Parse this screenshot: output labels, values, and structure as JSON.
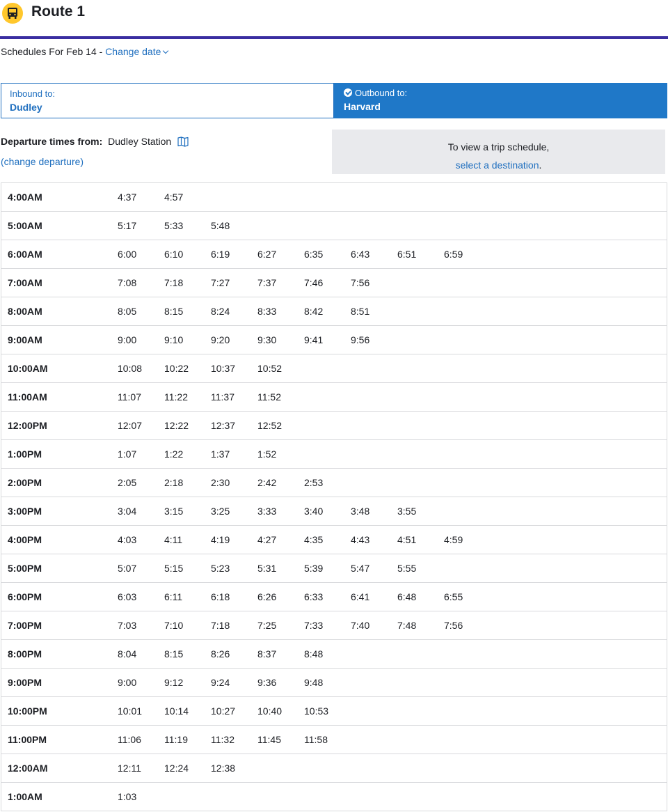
{
  "header": {
    "title": "Route 1",
    "icon": "bus-icon",
    "badge_color": "#ffc72c",
    "rule_color": "#3a2ea1"
  },
  "date_bar": {
    "prefix": "Schedules For Feb 14 - ",
    "change_date": "Change date"
  },
  "directions": {
    "inbound": {
      "label": "Inbound to:",
      "destination": "Dudley"
    },
    "outbound": {
      "label": "Outbound to:",
      "destination": "Harvard",
      "selected": true
    }
  },
  "departure": {
    "label": "Departure times from:",
    "station": "Dudley Station",
    "change_link": "(change departure)"
  },
  "info": {
    "line1": "To view a trip schedule,",
    "link": "select a destination",
    "suffix": "."
  },
  "schedule": [
    {
      "hour": "4:00AM",
      "times": [
        "4:37",
        "4:57"
      ]
    },
    {
      "hour": "5:00AM",
      "times": [
        "5:17",
        "5:33",
        "5:48"
      ]
    },
    {
      "hour": "6:00AM",
      "times": [
        "6:00",
        "6:10",
        "6:19",
        "6:27",
        "6:35",
        "6:43",
        "6:51",
        "6:59"
      ]
    },
    {
      "hour": "7:00AM",
      "times": [
        "7:08",
        "7:18",
        "7:27",
        "7:37",
        "7:46",
        "7:56"
      ]
    },
    {
      "hour": "8:00AM",
      "times": [
        "8:05",
        "8:15",
        "8:24",
        "8:33",
        "8:42",
        "8:51"
      ]
    },
    {
      "hour": "9:00AM",
      "times": [
        "9:00",
        "9:10",
        "9:20",
        "9:30",
        "9:41",
        "9:56"
      ]
    },
    {
      "hour": "10:00AM",
      "times": [
        "10:08",
        "10:22",
        "10:37",
        "10:52"
      ]
    },
    {
      "hour": "11:00AM",
      "times": [
        "11:07",
        "11:22",
        "11:37",
        "11:52"
      ]
    },
    {
      "hour": "12:00PM",
      "times": [
        "12:07",
        "12:22",
        "12:37",
        "12:52"
      ]
    },
    {
      "hour": "1:00PM",
      "times": [
        "1:07",
        "1:22",
        "1:37",
        "1:52"
      ]
    },
    {
      "hour": "2:00PM",
      "times": [
        "2:05",
        "2:18",
        "2:30",
        "2:42",
        "2:53"
      ]
    },
    {
      "hour": "3:00PM",
      "times": [
        "3:04",
        "3:15",
        "3:25",
        "3:33",
        "3:40",
        "3:48",
        "3:55"
      ]
    },
    {
      "hour": "4:00PM",
      "times": [
        "4:03",
        "4:11",
        "4:19",
        "4:27",
        "4:35",
        "4:43",
        "4:51",
        "4:59"
      ]
    },
    {
      "hour": "5:00PM",
      "times": [
        "5:07",
        "5:15",
        "5:23",
        "5:31",
        "5:39",
        "5:47",
        "5:55"
      ]
    },
    {
      "hour": "6:00PM",
      "times": [
        "6:03",
        "6:11",
        "6:18",
        "6:26",
        "6:33",
        "6:41",
        "6:48",
        "6:55"
      ]
    },
    {
      "hour": "7:00PM",
      "times": [
        "7:03",
        "7:10",
        "7:18",
        "7:25",
        "7:33",
        "7:40",
        "7:48",
        "7:56"
      ]
    },
    {
      "hour": "8:00PM",
      "times": [
        "8:04",
        "8:15",
        "8:26",
        "8:37",
        "8:48"
      ]
    },
    {
      "hour": "9:00PM",
      "times": [
        "9:00",
        "9:12",
        "9:24",
        "9:36",
        "9:48"
      ]
    },
    {
      "hour": "10:00PM",
      "times": [
        "10:01",
        "10:14",
        "10:27",
        "10:40",
        "10:53"
      ]
    },
    {
      "hour": "11:00PM",
      "times": [
        "11:06",
        "11:19",
        "11:32",
        "11:45",
        "11:58"
      ]
    },
    {
      "hour": "12:00AM",
      "times": [
        "12:11",
        "12:24",
        "12:38"
      ]
    },
    {
      "hour": "1:00AM",
      "times": [
        "1:03"
      ]
    }
  ]
}
